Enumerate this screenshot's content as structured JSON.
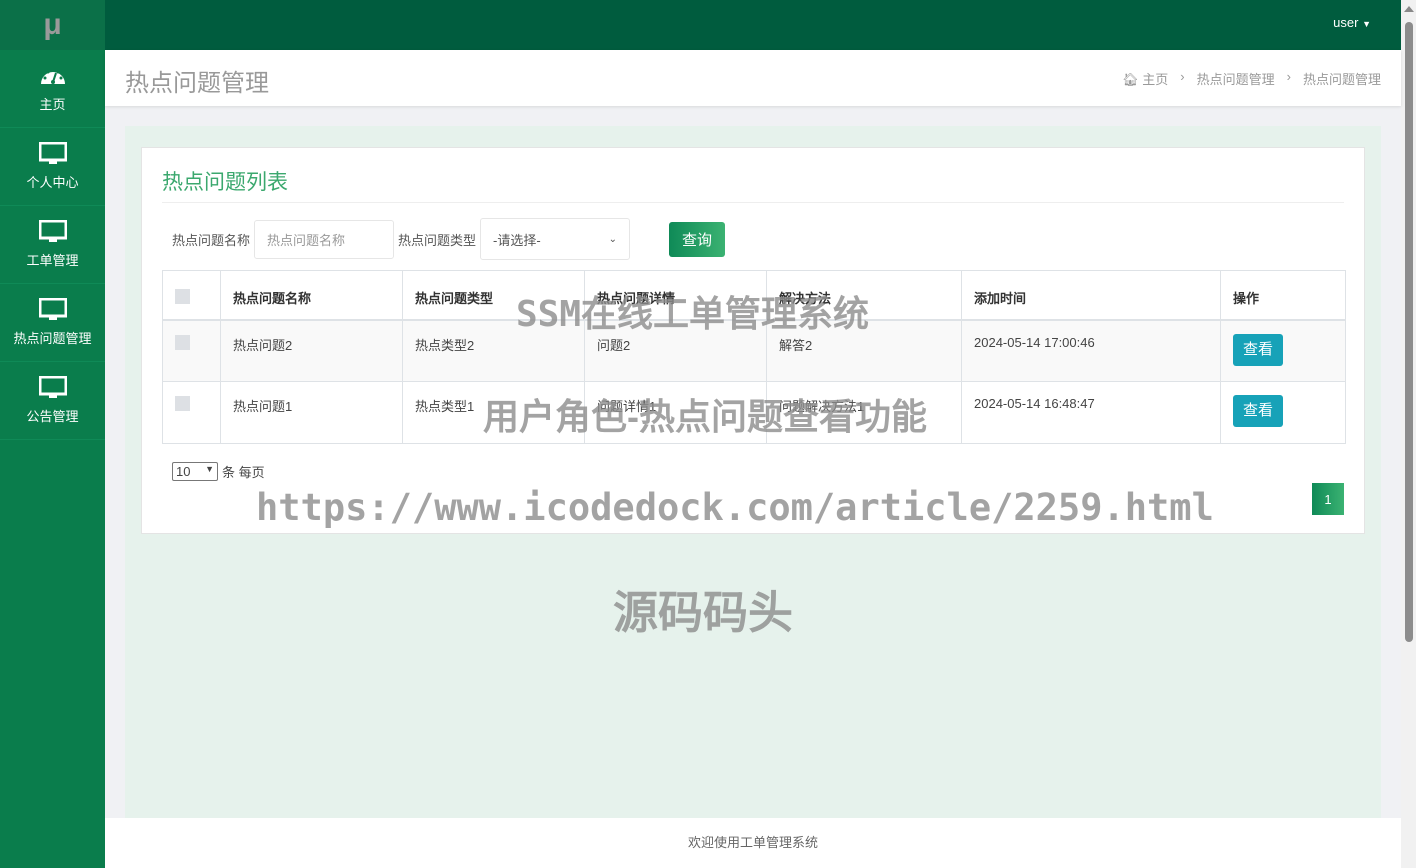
{
  "sidebar": {
    "logo": "μ",
    "items": [
      {
        "label": "主页",
        "icon": "dashboard-icon"
      },
      {
        "label": "个人中心",
        "icon": "monitor-icon"
      },
      {
        "label": "工单管理",
        "icon": "monitor-icon"
      },
      {
        "label": "热点问题管理",
        "icon": "monitor-icon"
      },
      {
        "label": "公告管理",
        "icon": "monitor-icon"
      }
    ]
  },
  "topbar": {
    "user": "user"
  },
  "header": {
    "title": "热点问题管理",
    "breadcrumb": [
      "主页",
      "热点问题管理",
      "热点问题管理"
    ]
  },
  "card": {
    "title": "热点问题列表"
  },
  "search": {
    "name_label": "热点问题名称",
    "name_placeholder": "热点问题名称",
    "type_label": "热点问题类型",
    "type_selected": "-请选择-",
    "query": "查询"
  },
  "table": {
    "headers": [
      "热点问题名称",
      "热点问题类型",
      "热点问题详情",
      "解决方法",
      "添加时间",
      "操作"
    ],
    "rows": [
      [
        "热点问题2",
        "热点类型2",
        "问题2",
        "解答2",
        "2024-05-14 17:00:46"
      ],
      [
        "热点问题1",
        "热点类型1",
        "问题详情1",
        "问题解决方法1",
        "2024-05-14 16:48:47"
      ]
    ],
    "view": "查看"
  },
  "pager": {
    "size": "10",
    "per_page": "条 每页",
    "current": "1"
  },
  "footer": "欢迎使用工单管理系统",
  "watermarks": [
    "SSM在线工单管理系统",
    "用户角色-热点问题查看功能",
    "https://www.icodedock.com/article/2259.html",
    "源码码头"
  ],
  "colors": {
    "sidebar": "#0a7d4c",
    "topbar": "#005c3e",
    "accent": "#3ba86e",
    "view_button": "#17a2b8"
  }
}
